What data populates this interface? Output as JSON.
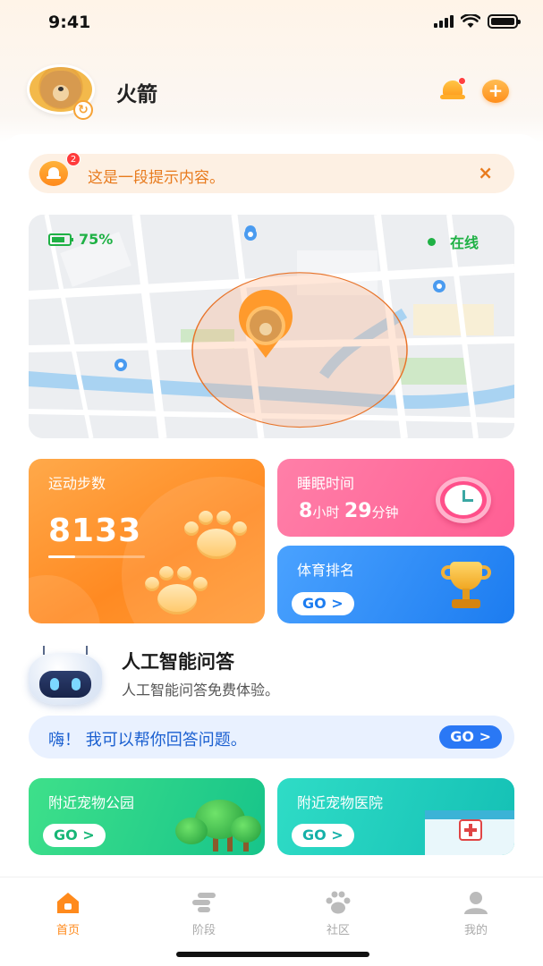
{
  "status_bar": {
    "time": "9:41"
  },
  "header": {
    "username": "火箭"
  },
  "notice": {
    "text": "这是一段提示内容。",
    "count": "2",
    "close": "×"
  },
  "map": {
    "battery": "75%",
    "status": "在线"
  },
  "steps": {
    "title": "运动步数",
    "value": "8133"
  },
  "sleep": {
    "title": "睡眠时间",
    "hours": "8",
    "hours_unit": "小时",
    "minutes": "29",
    "minutes_unit": "分钟"
  },
  "rank": {
    "title": "体育排名",
    "go": "GO >"
  },
  "ai": {
    "title": "人工智能问答",
    "subtitle": "人工智能问答免费体验。",
    "chat_text": "嗨！ 我可以帮你回答问题。",
    "go": "GO >"
  },
  "park": {
    "title": "附近宠物公园",
    "go": "GO >"
  },
  "hospital": {
    "title": "附近宠物医院",
    "go": "GO >"
  },
  "tabs": [
    {
      "label": "首页",
      "icon": "home-icon",
      "active": true
    },
    {
      "label": "阶段",
      "icon": "stages-icon",
      "active": false
    },
    {
      "label": "社区",
      "icon": "paw-icon",
      "active": false
    },
    {
      "label": "我的",
      "icon": "user-icon",
      "active": false
    }
  ],
  "colors": {
    "accent": "#ff8a1c",
    "online": "#1fb145",
    "chat": "#2a78f5"
  }
}
